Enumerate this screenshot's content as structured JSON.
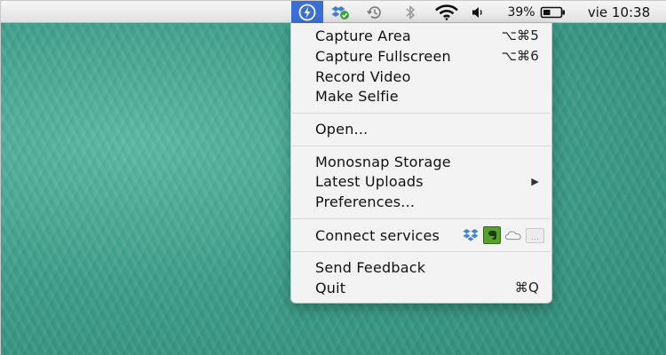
{
  "menubar": {
    "battery_percent": "39%",
    "clock": "vie 10:38",
    "icons": [
      "monosnap-icon",
      "dropbox-sync-icon",
      "time-machine-icon",
      "bluetooth-icon",
      "wifi-icon",
      "volume-icon",
      "battery-icon"
    ],
    "active_color": "#3a6fd6"
  },
  "menu": {
    "capture_area": {
      "label": "Capture Area",
      "shortcut": "⌥⌘5"
    },
    "capture_fullscreen": {
      "label": "Capture Fullscreen",
      "shortcut": "⌥⌘6"
    },
    "record_video": {
      "label": "Record Video"
    },
    "make_selfie": {
      "label": "Make Selfie"
    },
    "open": {
      "label": "Open..."
    },
    "monosnap_storage": {
      "label": "Monosnap Storage"
    },
    "latest_uploads": {
      "label": "Latest Uploads",
      "submenu_arrow": "▶"
    },
    "preferences": {
      "label": "Preferences..."
    },
    "connect_services": {
      "label": "Connect services",
      "services": [
        "dropbox-icon",
        "evernote-icon",
        "cloud-icon",
        "more-icon"
      ],
      "more_label": "..."
    },
    "send_feedback": {
      "label": "Send Feedback"
    },
    "quit": {
      "label": "Quit",
      "shortcut": "⌘Q"
    }
  }
}
